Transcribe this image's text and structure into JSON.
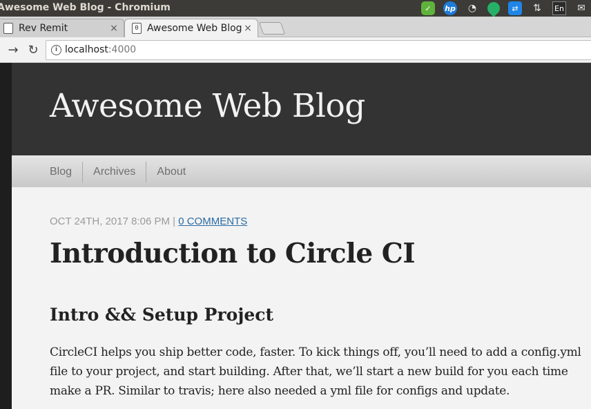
{
  "window": {
    "title": "Awesome Web Blog - Chromium",
    "tray": {
      "language": "En"
    }
  },
  "tabs": [
    {
      "label": "Rev Remit",
      "close": "×"
    },
    {
      "label": "Awesome Web Blog",
      "close": "×"
    }
  ],
  "toolbar": {
    "url_host": "localhost",
    "url_port": ":4000"
  },
  "blog": {
    "title": "Awesome Web Blog",
    "nav": [
      "Blog",
      "Archives",
      "About"
    ]
  },
  "post": {
    "meta_date": "OCT 24TH, 2017 8:06 PM",
    "meta_sep": " | ",
    "comments": "0 COMMENTS",
    "title": "Introduction to Circle CI",
    "section_title": "Intro && Setup Project",
    "body": "CircleCI helps you ship better code, faster. To kick things off, you’ll need to add a config.yml file to your project, and start building. After that, we’ll start a new build for you each time make a PR. Similar to travis; here also needed a yml file for configs and update."
  }
}
